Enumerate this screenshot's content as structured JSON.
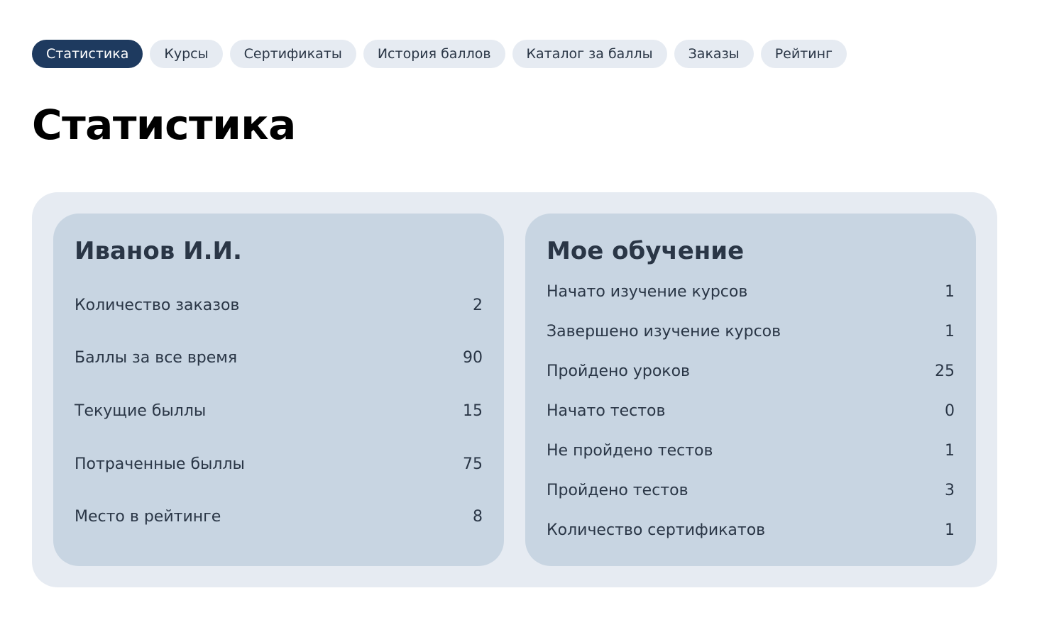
{
  "tabs": [
    {
      "label": "Статистика",
      "active": true
    },
    {
      "label": "Курсы",
      "active": false
    },
    {
      "label": "Сертификаты",
      "active": false
    },
    {
      "label": "История баллов",
      "active": false
    },
    {
      "label": "Каталог за баллы",
      "active": false
    },
    {
      "label": "Заказы",
      "active": false
    },
    {
      "label": "Рейтинг",
      "active": false
    }
  ],
  "page_title": "Статистика",
  "profile": {
    "name": "Иванов И.И.",
    "stats": [
      {
        "label": "Количество заказов",
        "value": "2"
      },
      {
        "label": "Баллы за все время",
        "value": "90"
      },
      {
        "label": "Текущие быллы",
        "value": "15"
      },
      {
        "label": "Потраченные быллы",
        "value": "75"
      },
      {
        "label": "Место в рейтинге",
        "value": "8"
      }
    ]
  },
  "learning": {
    "title": "Мое обучение",
    "stats": [
      {
        "label": "Начато изучение курсов",
        "value": "1"
      },
      {
        "label": "Завершено изучение курсов",
        "value": "1"
      },
      {
        "label": "Пройдено уроков",
        "value": "25"
      },
      {
        "label": "Начато тестов",
        "value": "0"
      },
      {
        "label": "Не пройдено тестов",
        "value": "1"
      },
      {
        "label": "Пройдено тестов",
        "value": "3"
      },
      {
        "label": "Количество сертификатов",
        "value": "1"
      }
    ]
  },
  "colors": {
    "active_tab": "#1e3a5f",
    "tab_bg": "#e6ebf2",
    "outer_panel": "#e6ebf2",
    "card_bg": "#c8d5e2",
    "text": "#2a3646"
  }
}
